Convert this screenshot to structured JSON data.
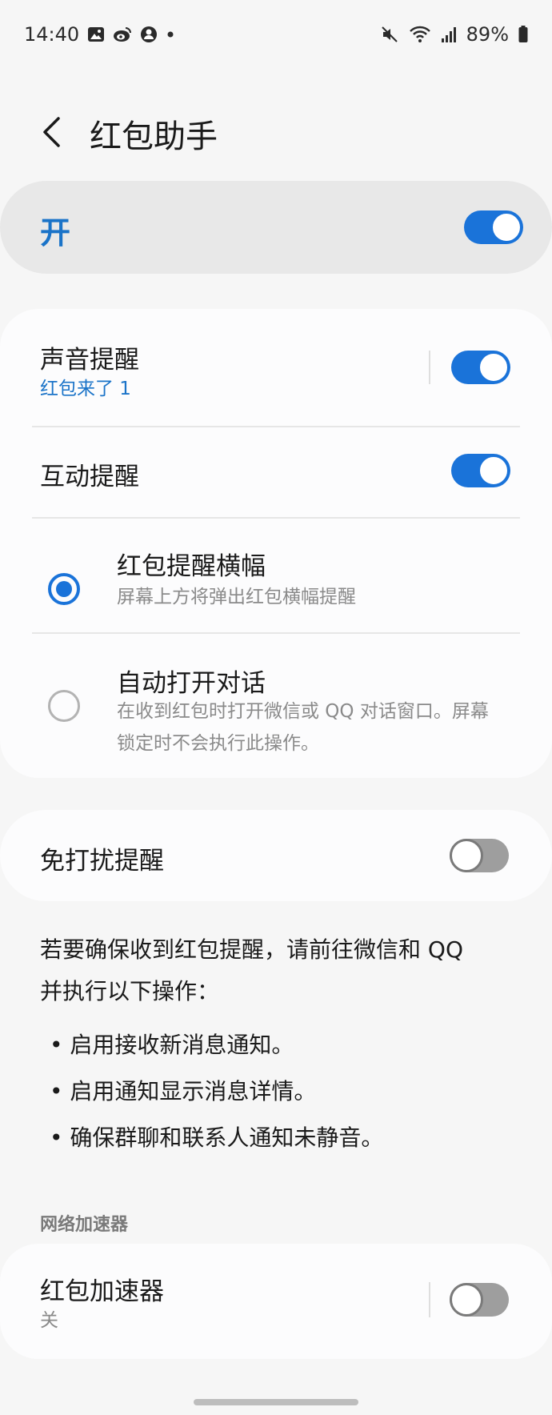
{
  "status_bar": {
    "time": "14:40",
    "battery": "89%"
  },
  "header": {
    "title": "红包助手"
  },
  "master": {
    "label": "开",
    "enabled": true
  },
  "sound_reminder": {
    "title": "声音提醒",
    "subtitle": "红包来了 1",
    "enabled": true
  },
  "interactive_reminder": {
    "title": "互动提醒",
    "enabled": true
  },
  "options": [
    {
      "title": "红包提醒横幅",
      "description": "屏幕上方将弹出红包横幅提醒",
      "selected": true
    },
    {
      "title": "自动打开对话",
      "description_line1": "在收到红包时打开微信或 QQ 对话窗口。屏幕",
      "description_line2": "锁定时不会执行此操作。",
      "selected": false
    }
  ],
  "dnd_reminder": {
    "title": "免打扰提醒",
    "enabled": false
  },
  "info": {
    "line1": "若要确保收到红包提醒，请前往微信和 QQ",
    "line2": "并执行以下操作：",
    "bullets": [
      "• 启用接收新消息通知。",
      "• 启用通知显示消息详情。",
      "• 确保群聊和联系人通知未静音。"
    ]
  },
  "network_section": {
    "label": "网络加速器"
  },
  "accelerator": {
    "title": "红包加速器",
    "status": "关",
    "enabled": false
  },
  "colors": {
    "accent": "#1a73d9",
    "background": "#f6f6f6",
    "card": "#fcfcfd"
  }
}
